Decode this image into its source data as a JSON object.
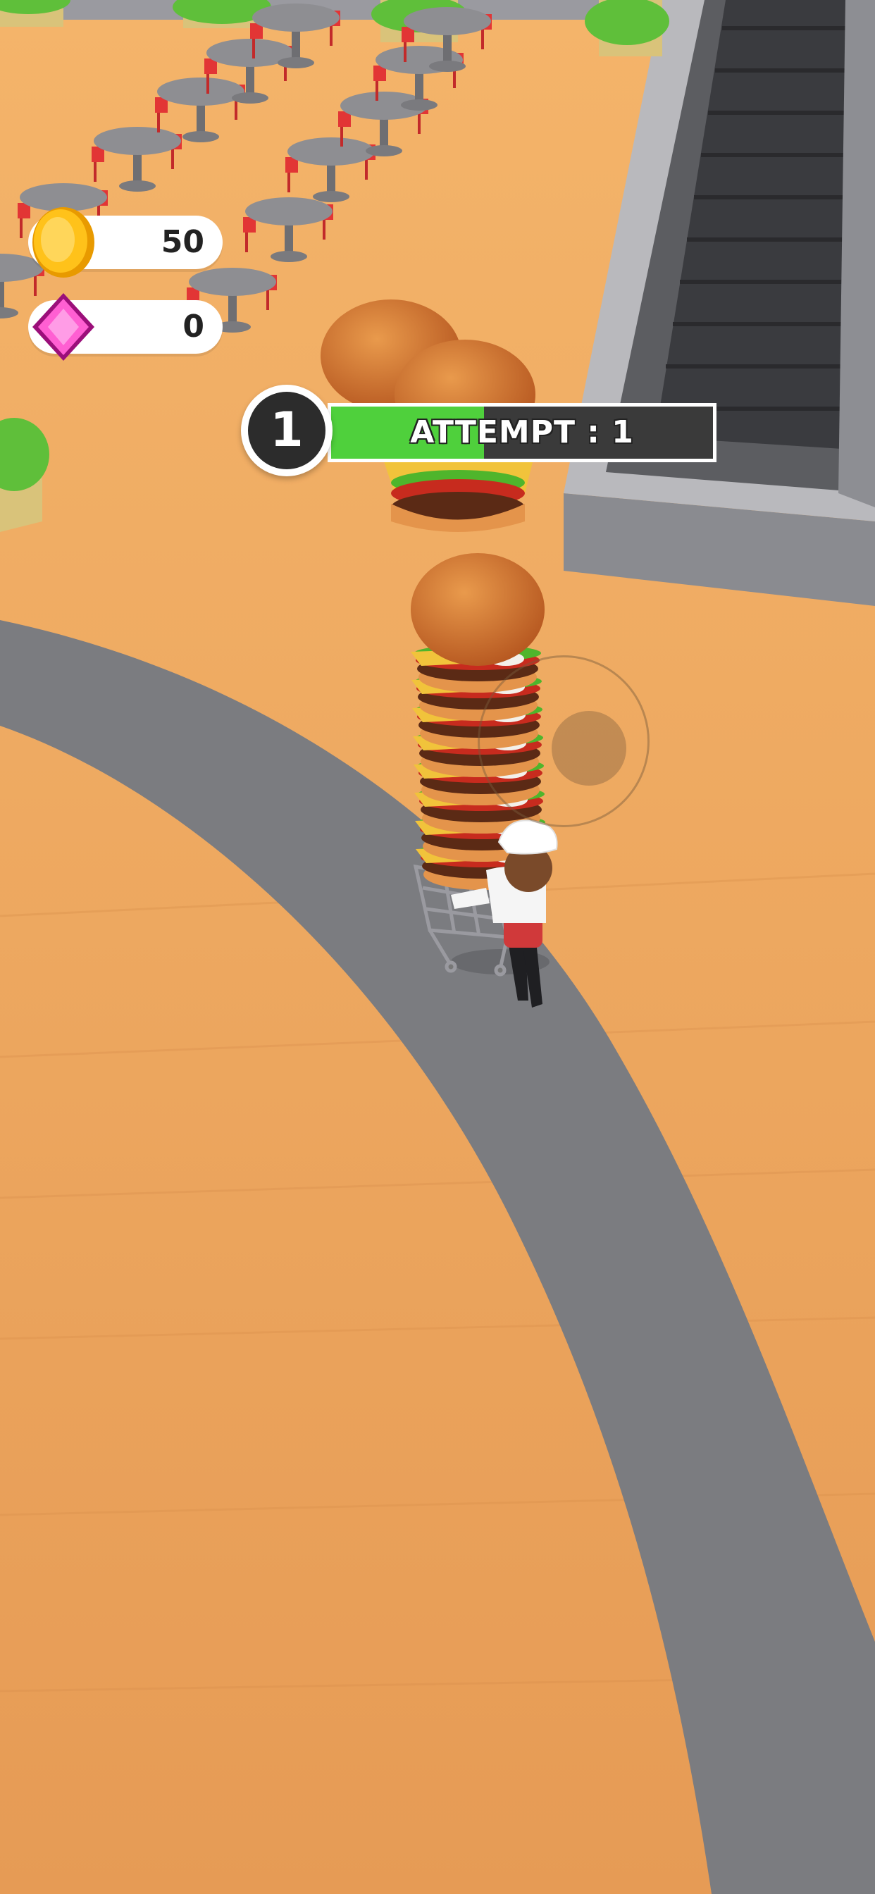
{
  "hud": {
    "coins": {
      "icon": "coin-icon",
      "value": "50",
      "color": "#f7b500"
    },
    "gems": {
      "icon": "gem-icon",
      "value": "0",
      "color": "#ff5fd2"
    }
  },
  "level": {
    "number": "1",
    "attempt_label": "ATTEMPT : 1",
    "progress": 0.4,
    "fill_color": "#4fd03c"
  },
  "scene": {
    "floor_color": "#eba55f",
    "path_color": "#7b7c80",
    "escalator_color": "#3a3b3f",
    "burger_stack_count": 8
  }
}
